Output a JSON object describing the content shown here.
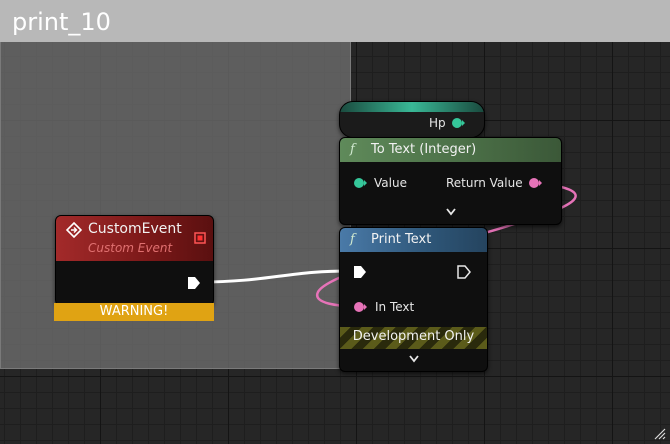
{
  "comment": {
    "title": "print_10"
  },
  "nodes": {
    "hp_getter": {
      "output_label": "Hp"
    },
    "to_text": {
      "title": "To Text (Integer)",
      "input_label": "Value",
      "output_label": "Return Value"
    },
    "print_text": {
      "title": "Print Text",
      "input_label": "In Text",
      "dev_label": "Development Only"
    },
    "custom_event": {
      "title": "CustomEvent",
      "subtitle": "Custom Event",
      "warning": "WARNING!"
    }
  },
  "icons": {
    "function": "f",
    "event": "diamond-arrow-icon"
  },
  "colors": {
    "float_pin": "#35c79a",
    "text_pin": "#e673b8",
    "exec_wire": "#ffffff",
    "warning": "#e0a313",
    "event_header": "#a32a2a",
    "function_header_green": "#5f8a5a",
    "function_header_blue": "#4a7aa8"
  }
}
